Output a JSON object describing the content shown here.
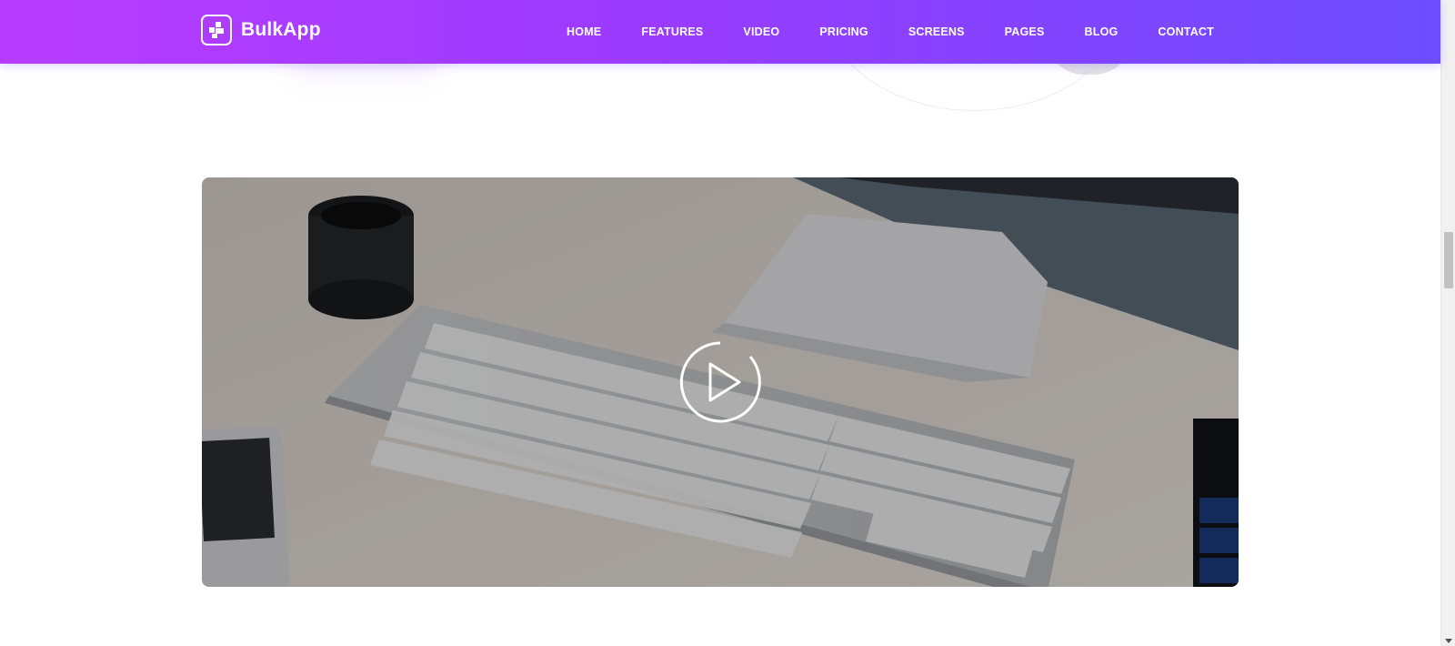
{
  "brand": {
    "name": "BulkApp"
  },
  "nav": {
    "items": [
      {
        "label": "HOME"
      },
      {
        "label": "FEATURES"
      },
      {
        "label": "VIDEO"
      },
      {
        "label": "PRICING"
      },
      {
        "label": "SCREENS"
      },
      {
        "label": "PAGES"
      },
      {
        "label": "BLOG"
      },
      {
        "label": "CONTACT"
      }
    ]
  },
  "colors": {
    "header_gradient_start": "#b83cff",
    "header_gradient_end": "#6c4dff",
    "header_text": "#ffffff",
    "video_overlay": "#000000"
  },
  "video": {
    "play_icon": "play-circle-icon"
  }
}
